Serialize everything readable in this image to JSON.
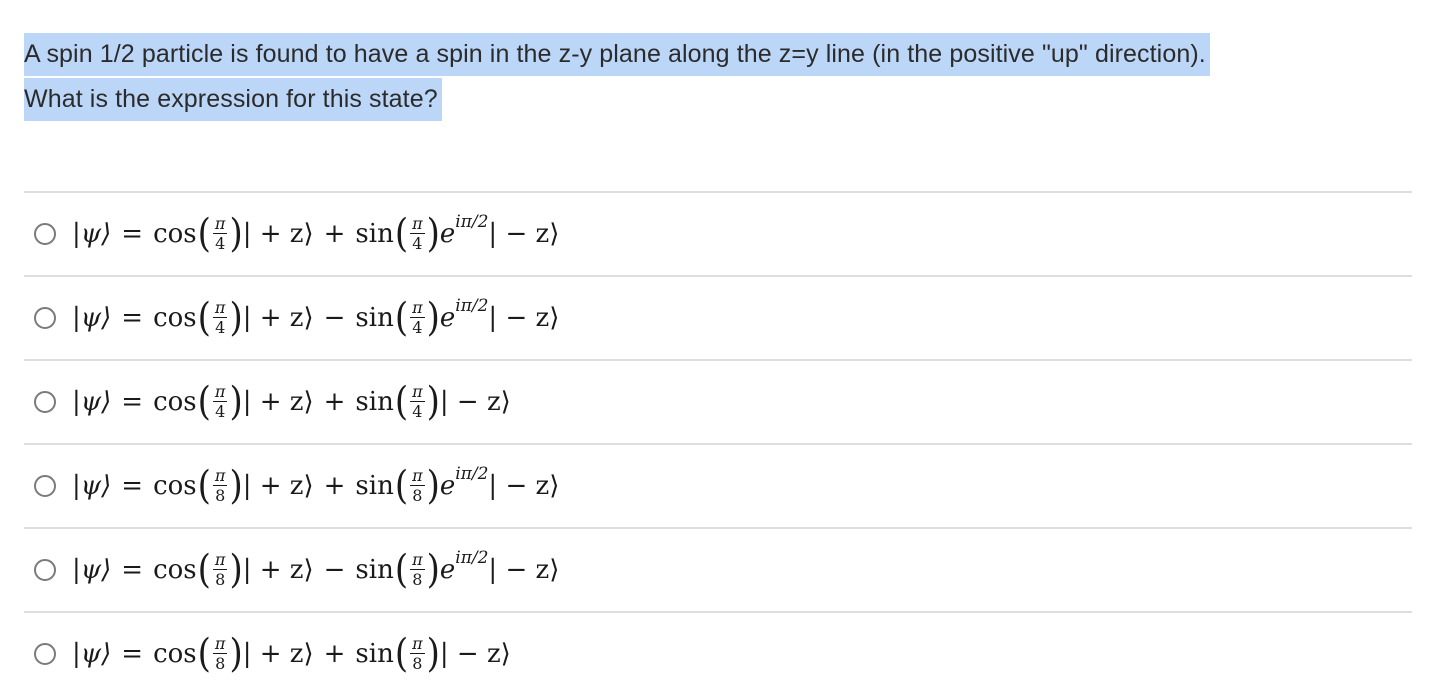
{
  "question": {
    "lines": [
      "A spin 1/2 particle is found to have a spin in the z-y plane along the z=y line (in the positive \"up\" direction).",
      "What is the expression for this state?"
    ],
    "selected": true
  },
  "colors": {
    "selection_highlight": "#bcd6f8",
    "separator": "#dedede",
    "radio_border": "#7a7a7a",
    "text": "#2b2b2b"
  },
  "options": [
    {
      "lhs": "|ψ⟩",
      "eq": "=",
      "cos_fn": "cos",
      "cos_num": "π",
      "cos_den": "4",
      "ket1": "| + z⟩",
      "sign": "+",
      "sin_fn": "sin",
      "sin_num": "π",
      "sin_den": "4",
      "phase_base": "e",
      "phase_exp": "iπ/2",
      "ket2": "| − z⟩",
      "selected": false
    },
    {
      "lhs": "|ψ⟩",
      "eq": "=",
      "cos_fn": "cos",
      "cos_num": "π",
      "cos_den": "4",
      "ket1": "| + z⟩",
      "sign": "−",
      "sin_fn": "sin",
      "sin_num": "π",
      "sin_den": "4",
      "phase_base": "e",
      "phase_exp": "iπ/2",
      "ket2": "| − z⟩",
      "selected": false
    },
    {
      "lhs": "|ψ⟩",
      "eq": "=",
      "cos_fn": "cos",
      "cos_num": "π",
      "cos_den": "4",
      "ket1": "| + z⟩",
      "sign": "+",
      "sin_fn": "sin",
      "sin_num": "π",
      "sin_den": "4",
      "phase_base": "",
      "phase_exp": "",
      "ket2": "| − z⟩",
      "selected": false
    },
    {
      "lhs": "|ψ⟩",
      "eq": "=",
      "cos_fn": "cos",
      "cos_num": "π",
      "cos_den": "8",
      "ket1": "| + z⟩",
      "sign": "+",
      "sin_fn": "sin",
      "sin_num": "π",
      "sin_den": "8",
      "phase_base": "e",
      "phase_exp": "iπ/2",
      "ket2": "| − z⟩",
      "selected": false
    },
    {
      "lhs": "|ψ⟩",
      "eq": "=",
      "cos_fn": "cos",
      "cos_num": "π",
      "cos_den": "8",
      "ket1": "| + z⟩",
      "sign": "−",
      "sin_fn": "sin",
      "sin_num": "π",
      "sin_den": "8",
      "phase_base": "e",
      "phase_exp": "iπ/2",
      "ket2": "| − z⟩",
      "selected": false
    },
    {
      "lhs": "|ψ⟩",
      "eq": "=",
      "cos_fn": "cos",
      "cos_num": "π",
      "cos_den": "8",
      "ket1": "| + z⟩",
      "sign": "+",
      "sin_fn": "sin",
      "sin_num": "π",
      "sin_den": "8",
      "phase_base": "",
      "phase_exp": "",
      "ket2": "| − z⟩",
      "selected": false
    }
  ]
}
